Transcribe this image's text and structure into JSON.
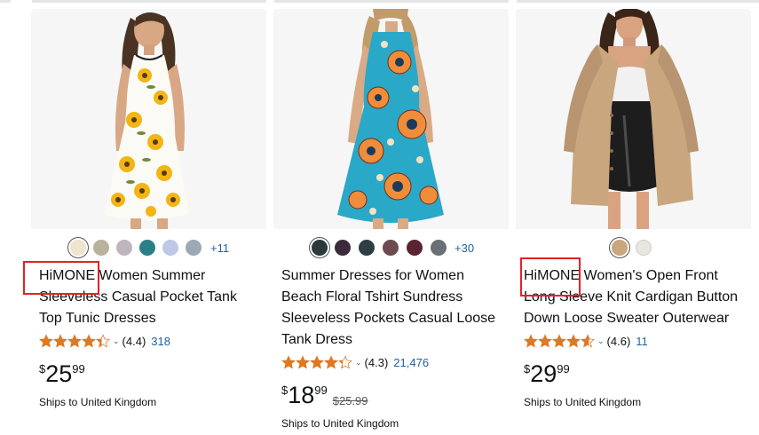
{
  "products": [
    {
      "image_alt": "Woman wearing white sleeveless sunflower print dress",
      "swatch_colors": [
        "#efe4cf",
        "#b9b39c",
        "#c0b5bd",
        "#2b7f86",
        "#bfc8e6",
        "#9aa9b3"
      ],
      "swatch_more": "+11",
      "title_brand": "HiMONE",
      "title_rest": " Women Summer Sleeveless Casual Pocket Tank Top Tunic Dresses",
      "stars": 4.4,
      "rating": "(4.4)",
      "reviews": "318",
      "currency": "$",
      "price_whole": "25",
      "price_fraction": "99",
      "list_price": "",
      "shipping": "Ships to United Kingdom"
    },
    {
      "image_alt": "Woman wearing turquoise floral mandala print sundress",
      "swatch_colors": [
        "#2a3a3a",
        "#3b2c3b",
        "#2e3e44",
        "#6c4b4e",
        "#5a2434",
        "#6b6f76"
      ],
      "swatch_more": "+30",
      "title_brand": "",
      "title_rest": "Summer Dresses for Women Beach Floral Tshirt Sundress Sleeveless Pockets Casual Loose Tank Dress",
      "stars": 4.3,
      "rating": "(4.3)",
      "reviews": "21,476",
      "currency": "$",
      "price_whole": "18",
      "price_fraction": "99",
      "list_price": "$25.99",
      "shipping": "Ships to United Kingdom"
    },
    {
      "image_alt": "Woman wearing beige knit cardigan over white top and black leather skirt",
      "swatch_colors": [
        "#c9a67e",
        "#e9e6e0"
      ],
      "swatch_more": "",
      "title_brand": "HiMONE",
      "title_rest": " Women's Open Front Long Sleeve Knit Cardigan Button Down Loose Sweater Outerwear",
      "stars": 4.6,
      "rating": "(4.6)",
      "reviews": "11",
      "currency": "$",
      "price_whole": "29",
      "price_fraction": "99",
      "list_price": "",
      "shipping": "Ships to United Kingdom"
    }
  ],
  "colors": {
    "star": "#de7921",
    "link": "#2162a1",
    "highlight": "#e5202a"
  }
}
